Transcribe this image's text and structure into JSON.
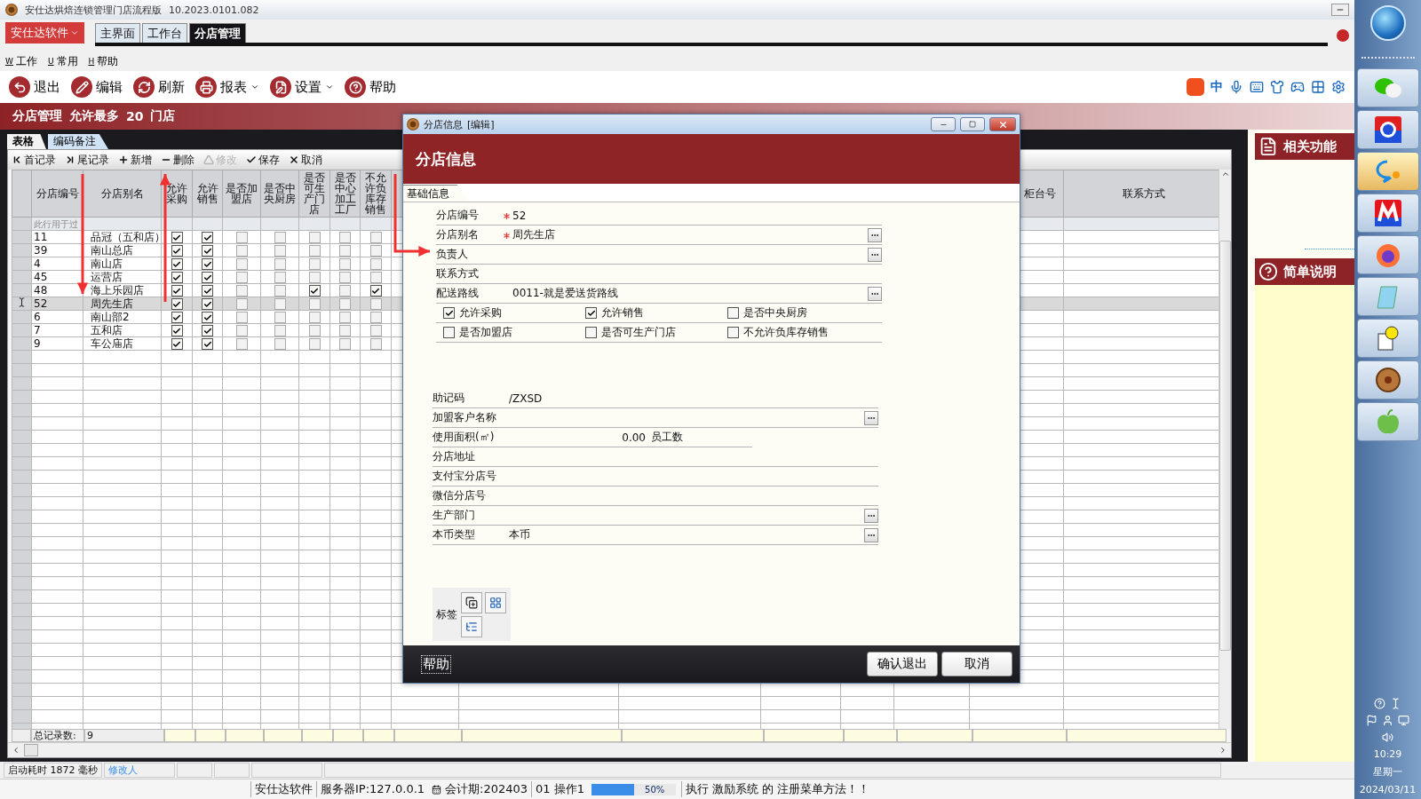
{
  "window": {
    "title": "安仕达烘焙连锁管理门店流程版",
    "version": "10.2023.0101.082"
  },
  "app_menu": "安仕达软件",
  "tabs": [
    {
      "label": "主界面",
      "selected": false
    },
    {
      "label": "工作台",
      "selected": false
    },
    {
      "label": "分店管理",
      "selected": true
    }
  ],
  "menu": [
    {
      "key": "W",
      "label": "工作"
    },
    {
      "key": "U",
      "label": "常用"
    },
    {
      "key": "H",
      "label": "帮助"
    }
  ],
  "toolbar": [
    {
      "label": "退出",
      "kind": "exit",
      "dropdown": false
    },
    {
      "label": "编辑",
      "kind": "edit",
      "dropdown": false
    },
    {
      "label": "刷新",
      "kind": "refresh",
      "dropdown": false
    },
    {
      "label": "报表",
      "kind": "print",
      "dropdown": true
    },
    {
      "label": "设置",
      "kind": "settings",
      "dropdown": true
    },
    {
      "label": "帮助",
      "kind": "help",
      "dropdown": false
    }
  ],
  "ime_bar": {
    "mode": "中"
  },
  "header": {
    "title": "分店管理",
    "limit_text": "允许最多",
    "limit": "20",
    "unit": "门店"
  },
  "view_tabs": [
    {
      "label": "表格",
      "selected": true
    },
    {
      "label": "编码备注",
      "selected": false
    }
  ],
  "grid_toolbar": [
    {
      "label": "首记录",
      "kind": "first",
      "disabled": false
    },
    {
      "label": "尾记录",
      "kind": "last",
      "disabled": false
    },
    {
      "label": "新增",
      "kind": "add",
      "disabled": false
    },
    {
      "label": "删除",
      "kind": "remove",
      "disabled": false
    },
    {
      "label": "修改",
      "kind": "modify",
      "disabled": true
    },
    {
      "label": "保存",
      "kind": "save",
      "disabled": false
    },
    {
      "label": "取消",
      "kind": "cancel",
      "disabled": false
    }
  ],
  "table": {
    "columns": [
      "分店编号",
      "分店别名",
      "允许采购",
      "允许销售",
      "是否加盟店",
      "是否中央厨房",
      "是否可生产门店",
      "是否中心加工工厂",
      "不允许负库存销售",
      "柜台号",
      "联系方式"
    ],
    "filter_hint": "此行用于过",
    "rows": [
      {
        "id": "11",
        "name": "品冠（五和店）",
        "flags": [
          true,
          true,
          false,
          false,
          false,
          false,
          false
        ],
        "selected": false
      },
      {
        "id": "39",
        "name": "南山总店",
        "flags": [
          true,
          true,
          false,
          false,
          false,
          false,
          false
        ],
        "selected": false
      },
      {
        "id": "4",
        "name": "南山店",
        "flags": [
          true,
          true,
          false,
          false,
          false,
          false,
          false
        ],
        "selected": false
      },
      {
        "id": "45",
        "name": "运营店",
        "flags": [
          true,
          true,
          false,
          false,
          false,
          false,
          false
        ],
        "selected": false
      },
      {
        "id": "48",
        "name": "海上乐园店",
        "flags": [
          true,
          true,
          false,
          false,
          true,
          false,
          true
        ],
        "selected": false
      },
      {
        "id": "52",
        "name": "周先生店",
        "flags": [
          true,
          true,
          false,
          false,
          false,
          false,
          false
        ],
        "selected": true
      },
      {
        "id": "6",
        "name": "南山部2",
        "flags": [
          true,
          true,
          false,
          false,
          false,
          false,
          false
        ],
        "selected": false
      },
      {
        "id": "7",
        "name": "五和店",
        "flags": [
          true,
          true,
          false,
          false,
          false,
          false,
          false
        ],
        "selected": false
      },
      {
        "id": "9",
        "name": "车公庙店",
        "flags": [
          true,
          true,
          false,
          false,
          false,
          false,
          false
        ],
        "selected": false
      }
    ],
    "footer_label": "总记录数:",
    "footer_value": "9"
  },
  "dialog": {
    "title": "分店信息",
    "mode": "[编辑]",
    "heading": "分店信息",
    "tabs": [
      {
        "label": "基础信息",
        "selected": true
      }
    ],
    "fields": [
      {
        "label": "分店编号",
        "required": true,
        "value": "52",
        "lookup": false
      },
      {
        "label": "分店别名",
        "required": true,
        "value": "周先生店",
        "lookup": true
      },
      {
        "label": "负责人",
        "required": false,
        "lookup": true
      },
      {
        "label": "联系方式",
        "required": false,
        "lookup": false
      },
      {
        "label": "配送路线",
        "required": false,
        "value": "0011-就是爱送货路线",
        "lookup": true
      }
    ],
    "options": [
      {
        "label": "允许采购",
        "checked": true
      },
      {
        "label": "允许销售",
        "checked": true
      },
      {
        "label": "是否中央厨房",
        "checked": false
      },
      {
        "label": "是否加盟店",
        "checked": false
      },
      {
        "label": "是否可生产门店",
        "checked": false
      },
      {
        "label": "不允许负库存销售",
        "checked": false
      }
    ],
    "fields2": [
      {
        "kind": "text",
        "label": "助记码",
        "value": "/ZXSD",
        "lookup": false
      },
      {
        "kind": "text",
        "label": "加盟客户名称",
        "lookup": true
      },
      {
        "kind": "area",
        "label": "使用面积(㎡)",
        "value": "0.00",
        "extra_label": "员工数"
      },
      {
        "kind": "text",
        "label": "分店地址",
        "lookup": false
      },
      {
        "kind": "text",
        "label": "支付宝分店号",
        "lookup": false
      },
      {
        "kind": "text",
        "label": "微信分店号",
        "lookup": false
      },
      {
        "kind": "text",
        "label": "生产部门",
        "lookup": true
      },
      {
        "kind": "text",
        "label": "本币类型",
        "value": "本币",
        "lookup": true
      }
    ],
    "tag_label": "标签",
    "help_button": "帮助",
    "confirm_button": "确认退出",
    "cancel_button": "取消"
  },
  "side_panel": [
    {
      "title": "相关功能",
      "kind": "document"
    },
    {
      "title": "简单说明",
      "kind": "help"
    }
  ],
  "status": [
    {
      "text": "启动耗时 1872 毫秒",
      "kind": "plain"
    },
    {
      "text": "修改人",
      "kind": "link"
    }
  ],
  "bottom_bar": {
    "company": "安仕达软件",
    "server": "服务器IP:127.0.0.1",
    "period": "会计期:202403",
    "operator": "01 操作1",
    "progress": {
      "level": 0.5,
      "label": "50%"
    },
    "message": "执行 激励系统 的 注册菜单方法！！"
  },
  "taskbar_apps": [
    {
      "kind": "chat",
      "selected": false
    },
    {
      "kind": "globe",
      "selected": false
    },
    {
      "kind": "bubble",
      "selected": true
    },
    {
      "kind": "zigzag",
      "selected": false
    },
    {
      "kind": "fox",
      "selected": false
    },
    {
      "kind": "notepad",
      "selected": false
    },
    {
      "kind": "helpdoc",
      "selected": false
    },
    {
      "kind": "donut",
      "selected": false
    },
    {
      "kind": "apple",
      "selected": false
    }
  ],
  "clock": {
    "time": "10:29",
    "weekday": "星期一",
    "date": "2024/03/11"
  }
}
